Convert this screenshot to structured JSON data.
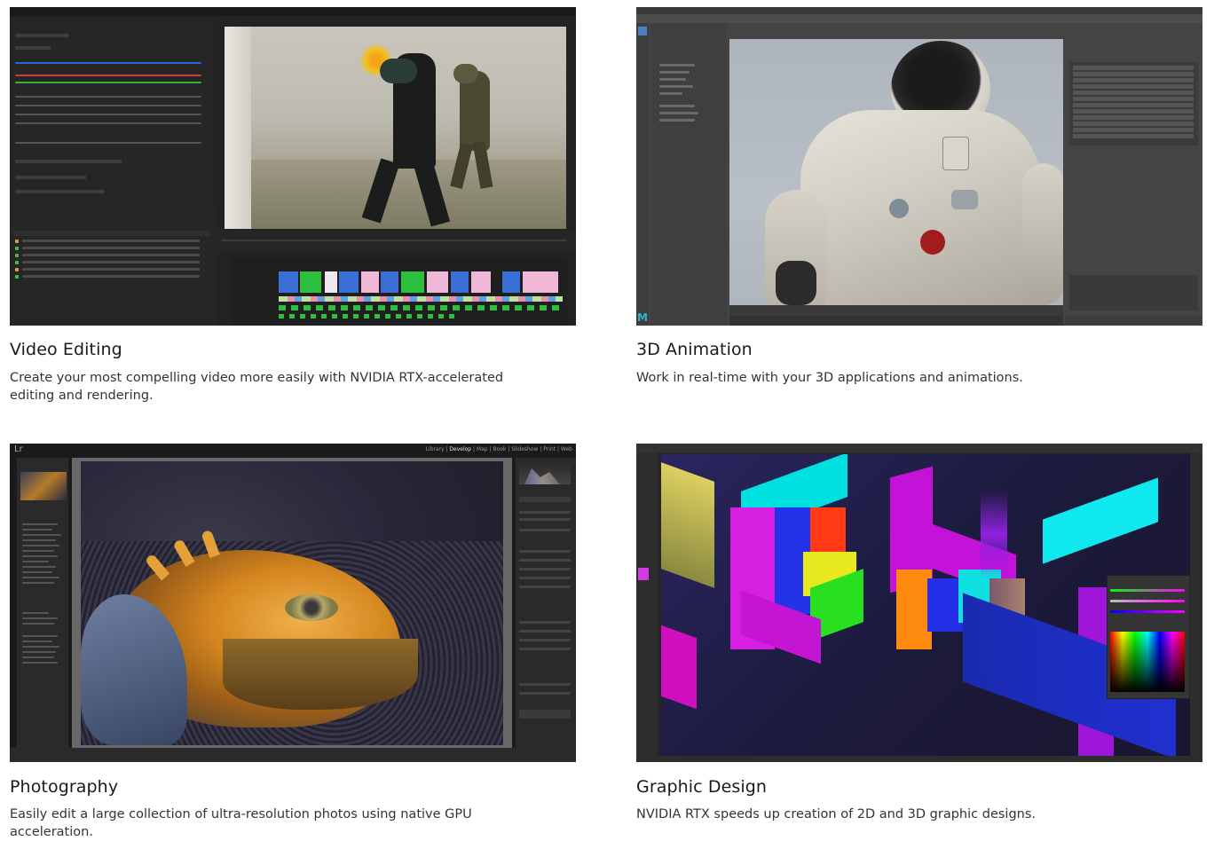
{
  "cards": [
    {
      "title": "Video Editing",
      "description": "Create your most compelling video more easily with NVIDIA RTX-accelerated editing and rendering.",
      "image_label": "video-editing-screenshot"
    },
    {
      "title": "3D Animation",
      "description": "Work in real-time with your 3D applications and animations.",
      "image_label": "3d-animation-screenshot"
    },
    {
      "title": "Photography",
      "description": "Easily edit a large collection of ultra-resolution photos using native GPU acceleration.",
      "image_label": "photography-screenshot"
    },
    {
      "title": "Graphic Design",
      "description": "NVIDIA RTX speeds up creation of 2D and 3D graphic designs.",
      "image_label": "graphic-design-screenshot"
    }
  ],
  "lightroom": {
    "logo": "Lr",
    "modules": [
      "Library",
      "Develop",
      "Map",
      "Book",
      "Slideshow",
      "Print",
      "Web"
    ]
  },
  "colors": {
    "app_dark": "#1e1e1e",
    "app_panel": "#2b2b2b",
    "timeline_blue": "#3b6fd8",
    "timeline_green": "#2fbf3f",
    "timeline_pink": "#f0b8d8",
    "maya_bg": "#4a4a4a",
    "ps_bg": "#262626"
  }
}
